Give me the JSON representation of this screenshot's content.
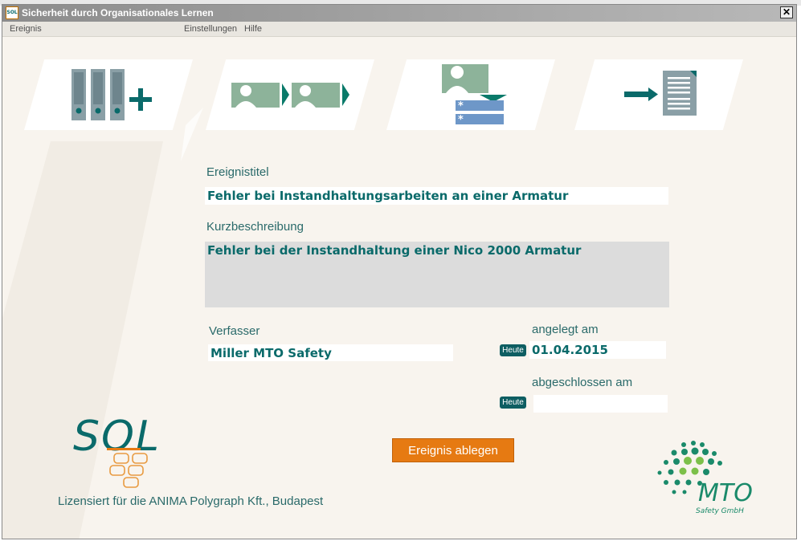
{
  "window": {
    "title": "Sicherheit durch Organisationales Lernen",
    "close_label": "✕"
  },
  "menu": {
    "items": [
      "Ereignis",
      "Einstellungen",
      "Hilfe"
    ]
  },
  "steps": [
    {
      "icon": "binders-add-icon"
    },
    {
      "icon": "persons-arrow-icon"
    },
    {
      "icon": "person-list-icon"
    },
    {
      "icon": "arrow-document-icon"
    }
  ],
  "form": {
    "title_label": "Ereignistitel",
    "title_value": "Fehler bei Instandhaltungsarbeiten an einer Armatur",
    "desc_label": "Kurzbeschreibung",
    "desc_value": "Fehler bei der Instandhaltung einer Nico 2000 Armatur",
    "author_label": "Verfasser",
    "author_value": "Miller MTO Safety",
    "created_label": "angelegt am",
    "created_value": "01.04.2015",
    "closed_label": "abgeschlossen am",
    "closed_value": "",
    "today_label": "Heute",
    "submit_label": "Ereignis ablegen"
  },
  "branding": {
    "logo_sol": "SOL",
    "license_text": "Lizensiert für die  ANIMA Polygraph Kft., Budapest",
    "mto_text": "MTO",
    "mto_sub": "Safety GmbH"
  },
  "colors": {
    "teal": "#0a6a6a",
    "orange": "#e67a12",
    "window_bg": "#f8f4ee"
  }
}
